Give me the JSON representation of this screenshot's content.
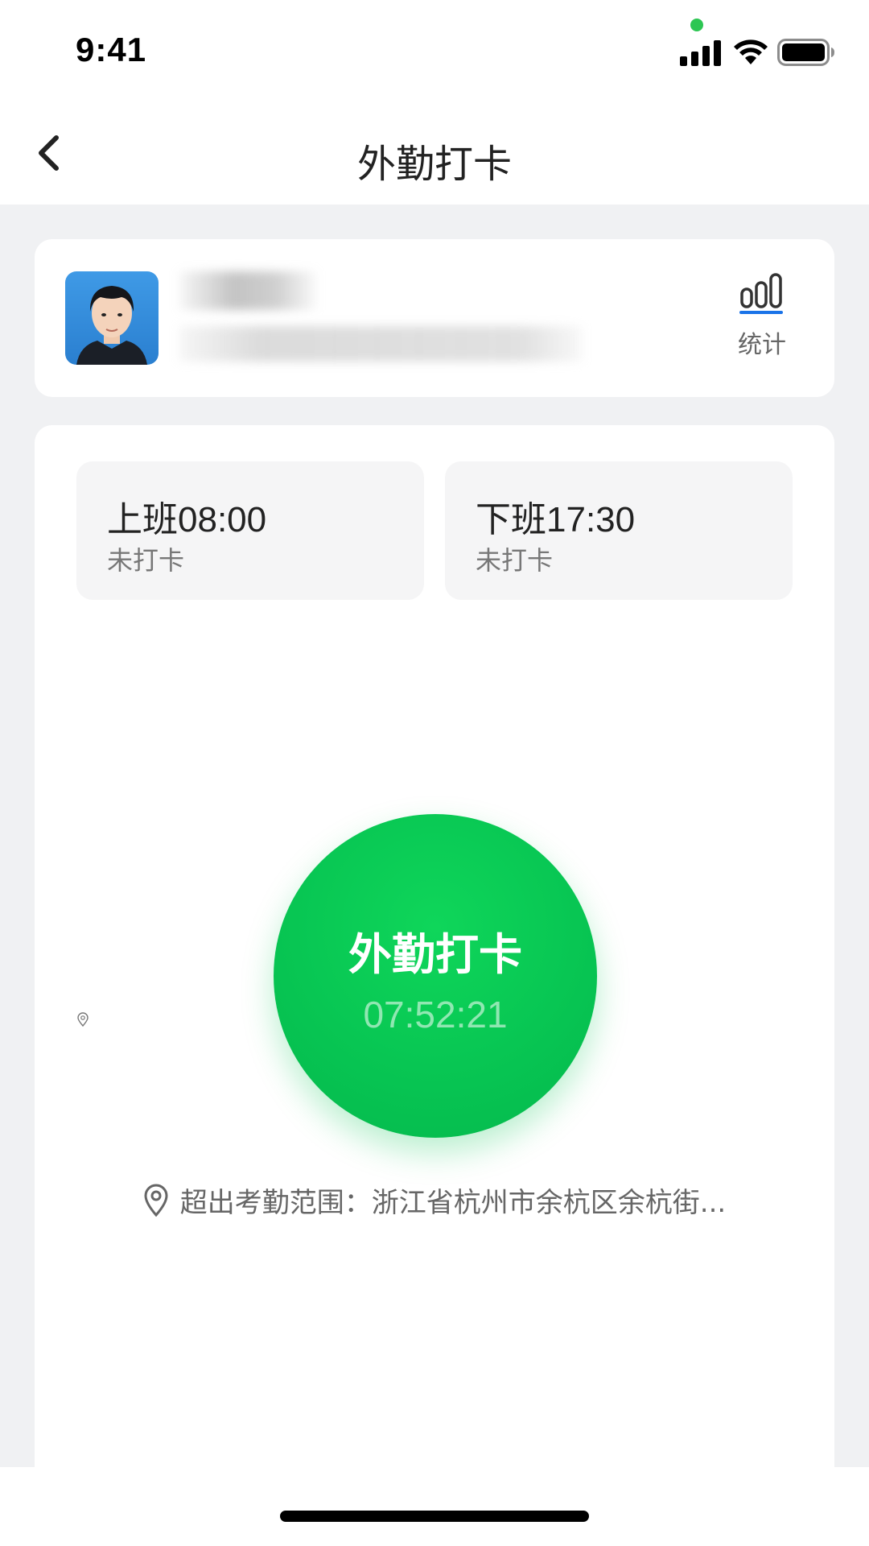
{
  "status_bar": {
    "time": "9:41",
    "icons": [
      "signal-icon",
      "wifi-icon",
      "battery-icon"
    ]
  },
  "nav": {
    "back_icon": "chevron-left-icon",
    "title": "外勤打卡"
  },
  "profile": {
    "stats_label": "统计",
    "stats_icon": "bar-chart-icon",
    "accent_color": "#1a73e8"
  },
  "shifts": [
    {
      "time_label": "上班08:00",
      "status": "未打卡"
    },
    {
      "time_label": "下班17:30",
      "status": "未打卡"
    }
  ],
  "punch": {
    "label": "外勤打卡",
    "clock": "07:52:21",
    "color": "#07c452"
  },
  "location": {
    "icon": "location-pin-icon",
    "text": "超出考勤范围：浙江省杭州市余杭区余杭街..."
  }
}
